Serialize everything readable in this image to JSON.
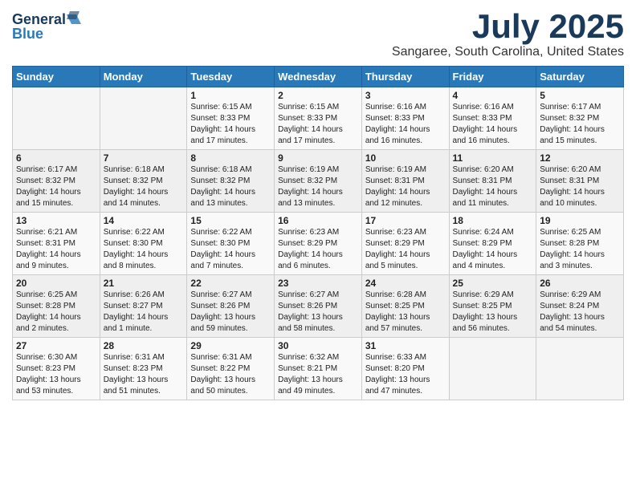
{
  "logo": {
    "line1": "General",
    "line2": "Blue"
  },
  "title": "July 2025",
  "subtitle": "Sangaree, South Carolina, United States",
  "days_of_week": [
    "Sunday",
    "Monday",
    "Tuesday",
    "Wednesday",
    "Thursday",
    "Friday",
    "Saturday"
  ],
  "weeks": [
    [
      {
        "day": "",
        "info": ""
      },
      {
        "day": "",
        "info": ""
      },
      {
        "day": "1",
        "info": "Sunrise: 6:15 AM\nSunset: 8:33 PM\nDaylight: 14 hours and 17 minutes."
      },
      {
        "day": "2",
        "info": "Sunrise: 6:15 AM\nSunset: 8:33 PM\nDaylight: 14 hours and 17 minutes."
      },
      {
        "day": "3",
        "info": "Sunrise: 6:16 AM\nSunset: 8:33 PM\nDaylight: 14 hours and 16 minutes."
      },
      {
        "day": "4",
        "info": "Sunrise: 6:16 AM\nSunset: 8:33 PM\nDaylight: 14 hours and 16 minutes."
      },
      {
        "day": "5",
        "info": "Sunrise: 6:17 AM\nSunset: 8:32 PM\nDaylight: 14 hours and 15 minutes."
      }
    ],
    [
      {
        "day": "6",
        "info": "Sunrise: 6:17 AM\nSunset: 8:32 PM\nDaylight: 14 hours and 15 minutes."
      },
      {
        "day": "7",
        "info": "Sunrise: 6:18 AM\nSunset: 8:32 PM\nDaylight: 14 hours and 14 minutes."
      },
      {
        "day": "8",
        "info": "Sunrise: 6:18 AM\nSunset: 8:32 PM\nDaylight: 14 hours and 13 minutes."
      },
      {
        "day": "9",
        "info": "Sunrise: 6:19 AM\nSunset: 8:32 PM\nDaylight: 14 hours and 13 minutes."
      },
      {
        "day": "10",
        "info": "Sunrise: 6:19 AM\nSunset: 8:31 PM\nDaylight: 14 hours and 12 minutes."
      },
      {
        "day": "11",
        "info": "Sunrise: 6:20 AM\nSunset: 8:31 PM\nDaylight: 14 hours and 11 minutes."
      },
      {
        "day": "12",
        "info": "Sunrise: 6:20 AM\nSunset: 8:31 PM\nDaylight: 14 hours and 10 minutes."
      }
    ],
    [
      {
        "day": "13",
        "info": "Sunrise: 6:21 AM\nSunset: 8:31 PM\nDaylight: 14 hours and 9 minutes."
      },
      {
        "day": "14",
        "info": "Sunrise: 6:22 AM\nSunset: 8:30 PM\nDaylight: 14 hours and 8 minutes."
      },
      {
        "day": "15",
        "info": "Sunrise: 6:22 AM\nSunset: 8:30 PM\nDaylight: 14 hours and 7 minutes."
      },
      {
        "day": "16",
        "info": "Sunrise: 6:23 AM\nSunset: 8:29 PM\nDaylight: 14 hours and 6 minutes."
      },
      {
        "day": "17",
        "info": "Sunrise: 6:23 AM\nSunset: 8:29 PM\nDaylight: 14 hours and 5 minutes."
      },
      {
        "day": "18",
        "info": "Sunrise: 6:24 AM\nSunset: 8:29 PM\nDaylight: 14 hours and 4 minutes."
      },
      {
        "day": "19",
        "info": "Sunrise: 6:25 AM\nSunset: 8:28 PM\nDaylight: 14 hours and 3 minutes."
      }
    ],
    [
      {
        "day": "20",
        "info": "Sunrise: 6:25 AM\nSunset: 8:28 PM\nDaylight: 14 hours and 2 minutes."
      },
      {
        "day": "21",
        "info": "Sunrise: 6:26 AM\nSunset: 8:27 PM\nDaylight: 14 hours and 1 minute."
      },
      {
        "day": "22",
        "info": "Sunrise: 6:27 AM\nSunset: 8:26 PM\nDaylight: 13 hours and 59 minutes."
      },
      {
        "day": "23",
        "info": "Sunrise: 6:27 AM\nSunset: 8:26 PM\nDaylight: 13 hours and 58 minutes."
      },
      {
        "day": "24",
        "info": "Sunrise: 6:28 AM\nSunset: 8:25 PM\nDaylight: 13 hours and 57 minutes."
      },
      {
        "day": "25",
        "info": "Sunrise: 6:29 AM\nSunset: 8:25 PM\nDaylight: 13 hours and 56 minutes."
      },
      {
        "day": "26",
        "info": "Sunrise: 6:29 AM\nSunset: 8:24 PM\nDaylight: 13 hours and 54 minutes."
      }
    ],
    [
      {
        "day": "27",
        "info": "Sunrise: 6:30 AM\nSunset: 8:23 PM\nDaylight: 13 hours and 53 minutes."
      },
      {
        "day": "28",
        "info": "Sunrise: 6:31 AM\nSunset: 8:23 PM\nDaylight: 13 hours and 51 minutes."
      },
      {
        "day": "29",
        "info": "Sunrise: 6:31 AM\nSunset: 8:22 PM\nDaylight: 13 hours and 50 minutes."
      },
      {
        "day": "30",
        "info": "Sunrise: 6:32 AM\nSunset: 8:21 PM\nDaylight: 13 hours and 49 minutes."
      },
      {
        "day": "31",
        "info": "Sunrise: 6:33 AM\nSunset: 8:20 PM\nDaylight: 13 hours and 47 minutes."
      },
      {
        "day": "",
        "info": ""
      },
      {
        "day": "",
        "info": ""
      }
    ]
  ]
}
